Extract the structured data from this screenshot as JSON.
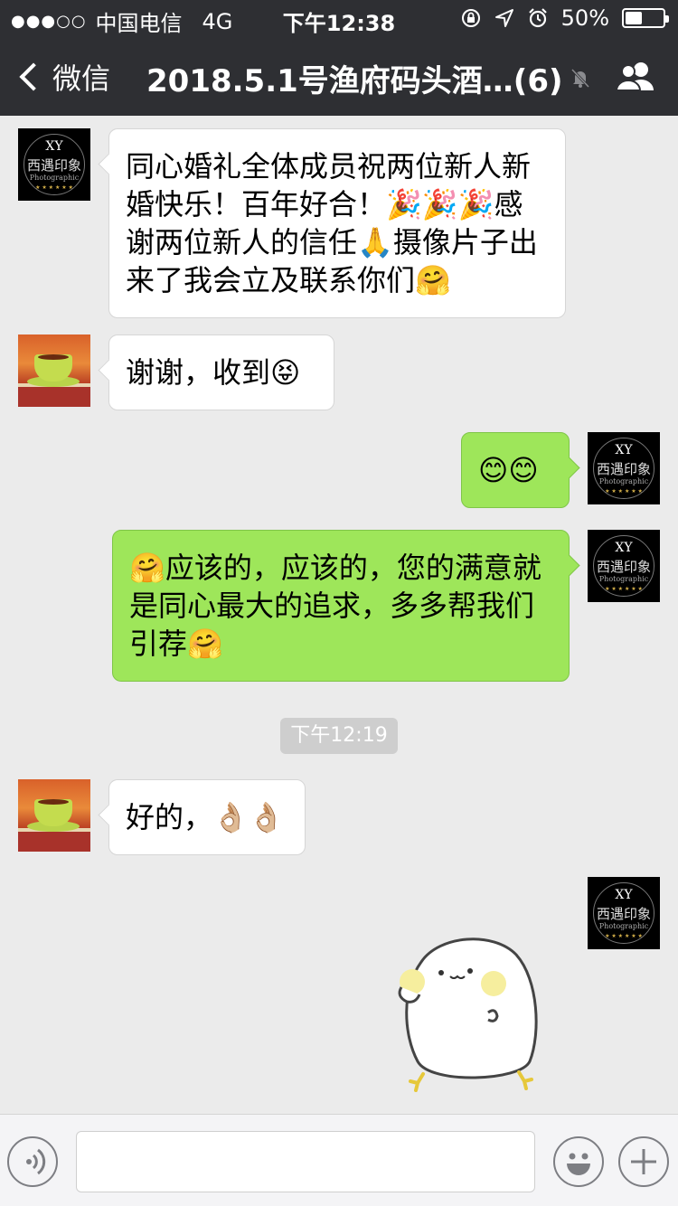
{
  "status_bar": {
    "signal": "●●●○○",
    "carrier": "中国电信",
    "network": "4G",
    "time": "下午12:38",
    "battery": "50%",
    "battery_level": 0.5,
    "icons": [
      "rotation-lock-icon",
      "location-arrow-icon",
      "alarm-icon",
      "battery-icon"
    ]
  },
  "nav": {
    "back_label": "微信",
    "title": "2018.5.1号渔府码头酒…(6)",
    "icons": [
      "chevron-left-icon",
      "mute-bell-icon",
      "group-members-icon"
    ]
  },
  "messages": [
    {
      "side": "left",
      "avatar": "xy-photography-logo",
      "text": "同心婚礼全体成员祝两位新人新婚快乐！百年好合！🎉🎉🎉感谢两位新人的信任🙏摄像片子出来了我会立及联系你们🤗"
    },
    {
      "side": "left",
      "avatar": "tea-cup-photo",
      "text": "谢谢，收到😝"
    },
    {
      "side": "right",
      "avatar": "xy-photography-logo",
      "text": "😊😊"
    },
    {
      "side": "right",
      "avatar": "xy-photography-logo",
      "text": "🤗应该的，应该的，您的满意就是同心最大的追求，多多帮我们引荐🤗"
    },
    {
      "side": "left",
      "avatar": "tea-cup-photo",
      "text": "好的，👌🏼👌🏼"
    },
    {
      "side": "right",
      "avatar": "xy-photography-logo",
      "sticker": "white-seal-sticker"
    }
  ],
  "timestamp": "下午12:19",
  "avatar_logo": {
    "line1": "XY",
    "line2": "西遇印象",
    "line3": "Photographic",
    "stars": "★ ★ ★ ★ ★ ★"
  },
  "input_bar": {
    "placeholder": "",
    "icons": [
      "voice-icon",
      "emoji-icon",
      "plus-icon"
    ]
  },
  "colors": {
    "nav_bg": "#2e2f33",
    "chat_bg": "#ebebeb",
    "right_bubble": "#9ee65a",
    "left_bubble": "#ffffff"
  }
}
